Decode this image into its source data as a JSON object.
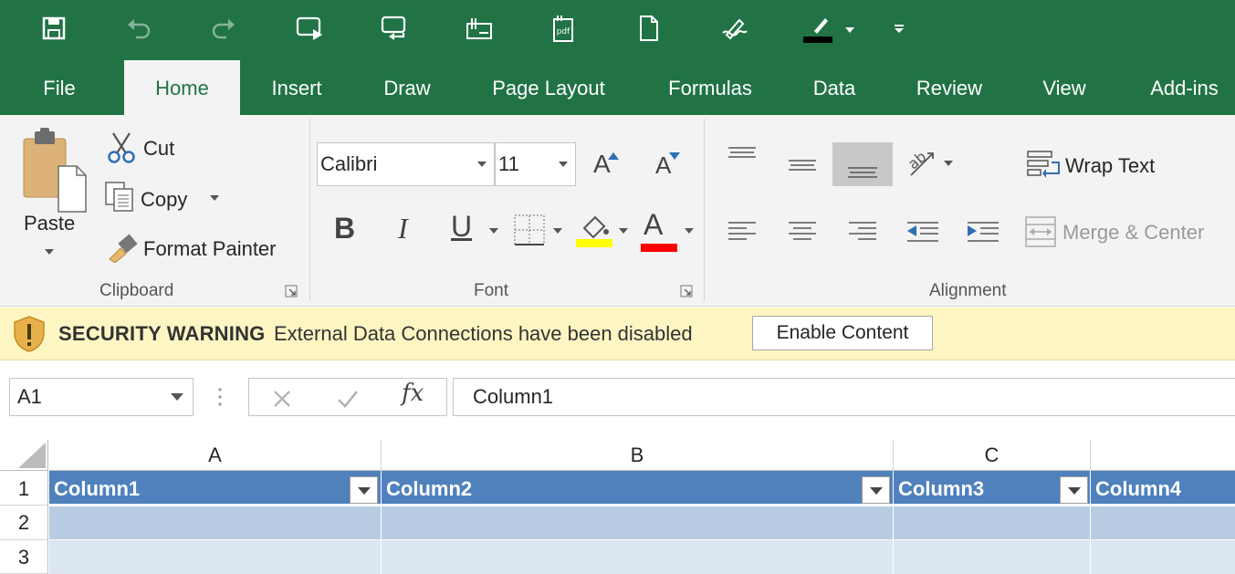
{
  "quick_access": {
    "icons": [
      "save-icon",
      "undo-icon",
      "redo-icon",
      "slideshow-icon",
      "reply-icon",
      "signature-icon",
      "pdf-icon",
      "new-document-icon",
      "draw-pen-icon",
      "pen-color-icon",
      "customize-arrow-icon"
    ]
  },
  "tabs": [
    "File",
    "Home",
    "Insert",
    "Draw",
    "Page Layout",
    "Formulas",
    "Data",
    "Review",
    "View",
    "Add-ins"
  ],
  "active_tab": "Home",
  "clipboard": {
    "paste": "Paste",
    "cut": "Cut",
    "copy": "Copy",
    "format_painter": "Format Painter",
    "label": "Clipboard"
  },
  "font": {
    "name": "Calibri",
    "size": "11",
    "grow": "A",
    "shrink": "A",
    "bold": "B",
    "italic": "I",
    "underline": "U",
    "font_color_glyph": "A",
    "highlight_color": "#ffff00",
    "font_color": "#ff0000",
    "label": "Font"
  },
  "alignment": {
    "wrap_text": "Wrap Text",
    "merge_center": "Merge & Center",
    "label": "Alignment"
  },
  "security": {
    "title": "SECURITY WARNING",
    "message": "External Data Connections have been disabled",
    "button": "Enable Content"
  },
  "formula_bar": {
    "name_box": "A1",
    "fx": "fx",
    "value": "Column1"
  },
  "sheet": {
    "columns": [
      "A",
      "B",
      "C"
    ],
    "rows": [
      "1",
      "2",
      "3"
    ],
    "header_cells": [
      "Column1",
      "Column2",
      "Column3",
      "Column4"
    ],
    "header_color": "#4f81bd",
    "band_color_1": "#b8cce4",
    "band_color_2": "#dce6f1"
  },
  "colors": {
    "accent": "#217346",
    "ribbon_bg": "#f3f3f3",
    "warning_bg": "#fdf6c3"
  }
}
